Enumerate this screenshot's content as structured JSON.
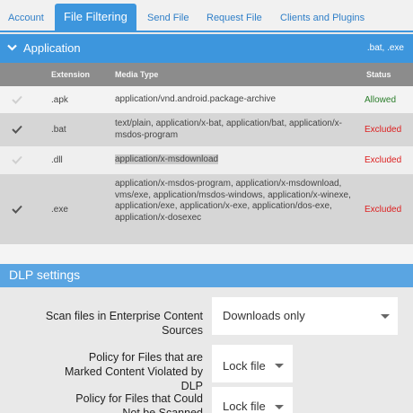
{
  "tabs": [
    {
      "label": "Account"
    },
    {
      "label": "File Filtering",
      "active": true
    },
    {
      "label": "Send File"
    },
    {
      "label": "Request File"
    },
    {
      "label": "Clients and Plugins"
    }
  ],
  "application": {
    "title": "Application",
    "extensions_summary": ".bat, .exe",
    "columns": {
      "extension": "Extension",
      "media_type": "Media Type",
      "status": "Status"
    },
    "rows": [
      {
        "checked": false,
        "extension": ".apk",
        "media_type": "application/vnd.android.package-archive",
        "status": "Allowed"
      },
      {
        "checked": true,
        "extension": ".bat",
        "media_type": "text/plain, application/x-bat, application/bat, application/x-msdos-program",
        "status": "Excluded"
      },
      {
        "checked": false,
        "extension": ".dll",
        "media_type": "application/x-msdownload",
        "status": "Excluded"
      },
      {
        "checked": true,
        "extension": ".exe",
        "media_type": "application/x-msdos-program, application/x-msdownload, vms/exe, application/msdos-windows, application/x-winexe, application/exe, application/x-exe, application/dos-exe, application/x-dosexec",
        "status": "Excluded"
      }
    ]
  },
  "dlp": {
    "title": "DLP settings",
    "settings": [
      {
        "label": "Scan files in Enterprise Content Sources",
        "value": "Downloads only"
      },
      {
        "label": "Policy for Files that are Marked Content Violated by DLP",
        "value": "Lock file"
      },
      {
        "label": "Policy for Files that Could Not be Scanned",
        "value": "Lock file"
      }
    ]
  },
  "colors": {
    "accent": "#3d96dd",
    "allowed": "#2a7d2a",
    "excluded": "#dd1f1f"
  }
}
